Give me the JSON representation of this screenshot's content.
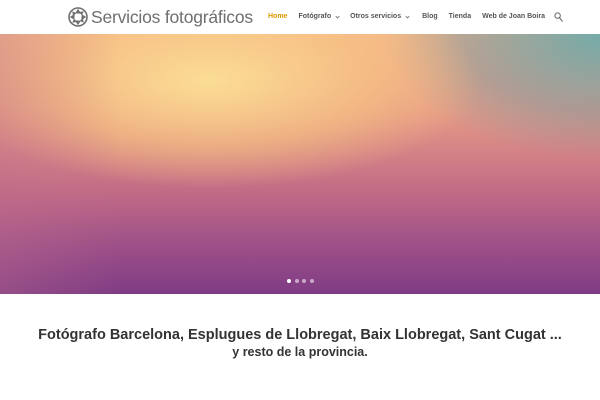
{
  "header": {
    "logo_text": "Servicios fotográficos",
    "logo_icon": "camera-aperture-icon"
  },
  "nav": {
    "items": [
      {
        "label": "Home",
        "active": true,
        "has_dropdown": false
      },
      {
        "label": "Fotógrafo",
        "active": false,
        "has_dropdown": true
      },
      {
        "label": "Otros servicios",
        "active": false,
        "has_dropdown": true
      },
      {
        "label": "Blog",
        "active": false,
        "has_dropdown": false
      },
      {
        "label": "Tienda",
        "active": false,
        "has_dropdown": false
      },
      {
        "label": "Web de Joan Boira",
        "active": false,
        "has_dropdown": false
      }
    ],
    "search_icon": "search-icon",
    "active_color": "#e09900"
  },
  "hero": {
    "slides_count": 4,
    "active_slide": 1
  },
  "content": {
    "heading": "Fotógrafo Barcelona, Esplugues de Llobregat, Baix Llobregat, Sant Cugat ...",
    "subheading": "y resto de la provincia."
  }
}
